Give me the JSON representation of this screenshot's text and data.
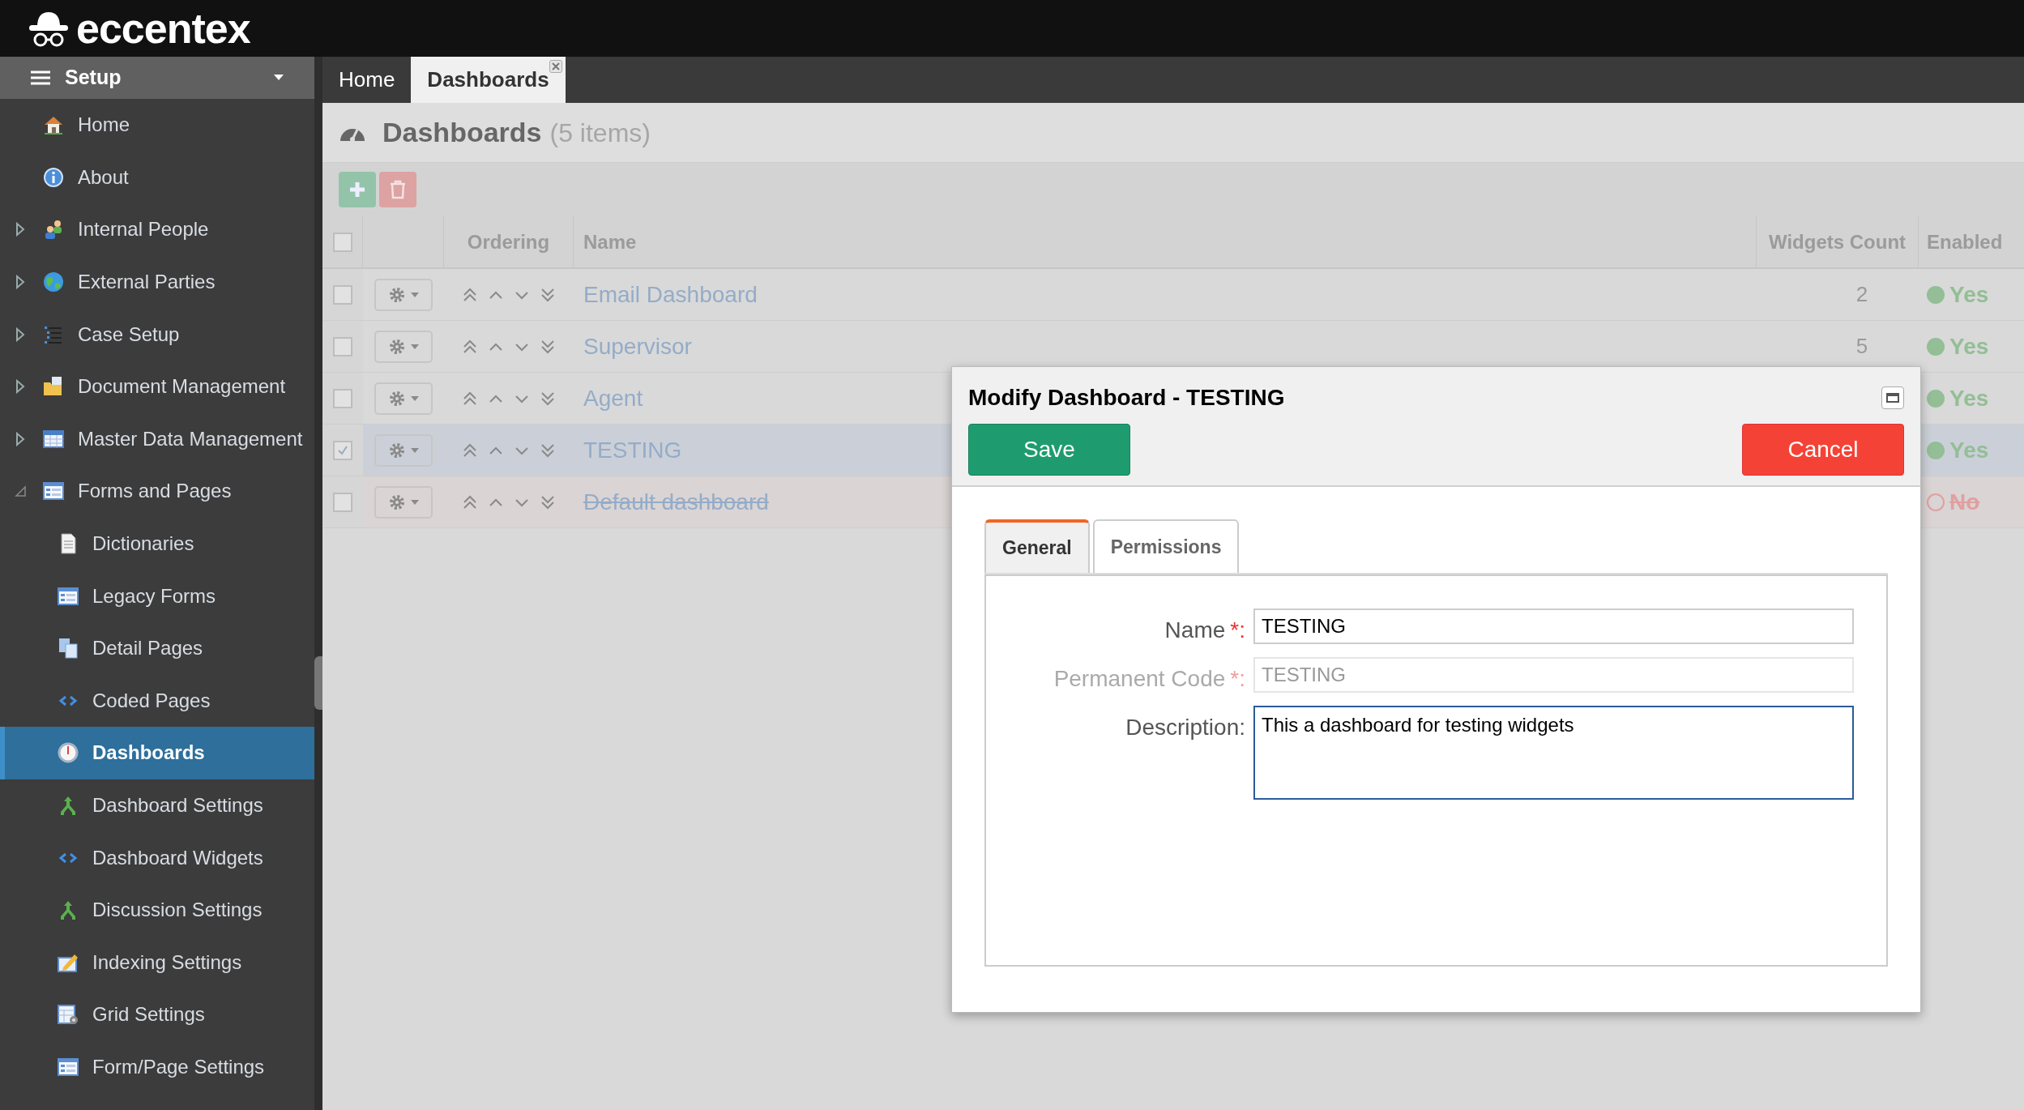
{
  "brand": {
    "name": "eccentex"
  },
  "sidebar": {
    "title": "Setup",
    "items": [
      {
        "label": "Home",
        "kind": "link",
        "selected": false
      },
      {
        "label": "About",
        "kind": "link",
        "selected": false
      },
      {
        "label": "Internal People",
        "kind": "group",
        "expanded": false,
        "selected": false
      },
      {
        "label": "External Parties",
        "kind": "group",
        "expanded": false,
        "selected": false
      },
      {
        "label": "Case Setup",
        "kind": "group",
        "expanded": false,
        "selected": false
      },
      {
        "label": "Document Management",
        "kind": "group",
        "expanded": false,
        "selected": false
      },
      {
        "label": "Master Data Management",
        "kind": "group",
        "expanded": false,
        "selected": false
      },
      {
        "label": "Forms and Pages",
        "kind": "group",
        "expanded": true,
        "selected": false,
        "children": [
          {
            "label": "Dictionaries",
            "selected": false
          },
          {
            "label": "Legacy Forms",
            "selected": false
          },
          {
            "label": "Detail Pages",
            "selected": false
          },
          {
            "label": "Coded Pages",
            "selected": false
          },
          {
            "label": "Dashboards",
            "selected": true
          },
          {
            "label": "Dashboard Settings",
            "selected": false
          },
          {
            "label": "Dashboard Widgets",
            "selected": false
          },
          {
            "label": "Discussion Settings",
            "selected": false
          },
          {
            "label": "Indexing Settings",
            "selected": false
          },
          {
            "label": "Grid Settings",
            "selected": false
          },
          {
            "label": "Form/Page Settings",
            "selected": false
          }
        ]
      }
    ]
  },
  "tabs": [
    {
      "label": "Home",
      "selected": false,
      "closable": false
    },
    {
      "label": "Dashboards",
      "selected": true,
      "closable": true
    }
  ],
  "page": {
    "title": "Dashboards",
    "count": "(5 items)"
  },
  "table": {
    "all_checked": false,
    "columns": [
      "Ordering",
      "Name",
      "Widgets Count",
      "Enabled"
    ],
    "rows": [
      {
        "name": "Email Dashboard",
        "widgets_count": "2",
        "enabled": "Yes",
        "is_enabled": true,
        "checked": false,
        "selected": false
      },
      {
        "name": "Supervisor",
        "widgets_count": "5",
        "enabled": "Yes",
        "is_enabled": true,
        "checked": false,
        "selected": false
      },
      {
        "name": "Agent",
        "enabled": "Yes",
        "is_enabled": true,
        "checked": false,
        "selected": false
      },
      {
        "name": "TESTING",
        "enabled": "Yes",
        "is_enabled": true,
        "checked": true,
        "selected": true
      },
      {
        "name": "Default dashboard",
        "enabled": "No",
        "is_enabled": false,
        "checked": false,
        "selected": false
      }
    ]
  },
  "dialog": {
    "title": "Modify Dashboard - TESTING",
    "save": "Save",
    "cancel": "Cancel",
    "tabs": [
      {
        "label": "General",
        "selected": true
      },
      {
        "label": "Permissions",
        "selected": false
      }
    ],
    "fields": [
      {
        "label": "Name",
        "marker": "*:",
        "disabled": false,
        "kind": "text",
        "value": "TESTING"
      },
      {
        "label": "Permanent Code",
        "marker": "*:",
        "disabled": true,
        "kind": "text",
        "value": "TESTING"
      },
      {
        "label": "Description:",
        "kind": "textarea",
        "value": "This a dashboard for testing widgets"
      }
    ]
  }
}
